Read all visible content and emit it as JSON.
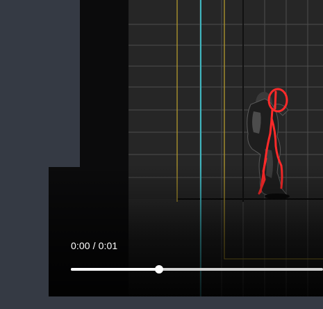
{
  "player": {
    "time_display": "0:00 / 0:01",
    "progress_fraction": 0.35
  },
  "colors": {
    "page_background": "#353a44",
    "grid_line": "#5a5a5a",
    "cyan_guide": "#3fb6c0",
    "yellow_guide": "#b49a2e",
    "annotation": "#ff2a2a"
  }
}
